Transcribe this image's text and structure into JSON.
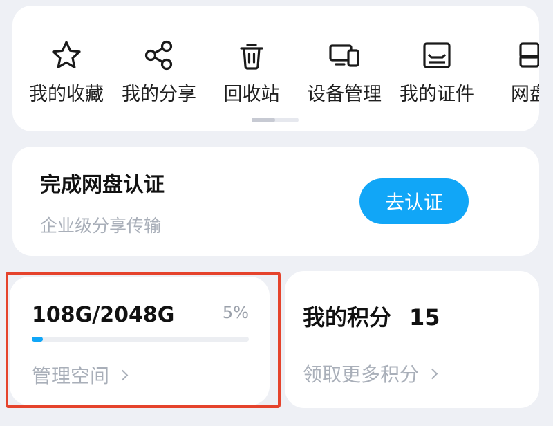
{
  "shortcuts": [
    {
      "label": "我的收藏",
      "icon": "star-icon"
    },
    {
      "label": "我的分享",
      "icon": "share-icon"
    },
    {
      "label": "回收站",
      "icon": "trash-icon"
    },
    {
      "label": "设备管理",
      "icon": "devices-icon"
    },
    {
      "label": "我的证件",
      "icon": "id-card-icon"
    },
    {
      "label": "网盘",
      "icon": "cloud-drive-icon"
    }
  ],
  "cert": {
    "title": "完成网盘认证",
    "subtitle": "企业级分享传输",
    "button_label": "去认证"
  },
  "storage": {
    "used_label": "108G/2048G",
    "percent_label": "5%",
    "usage_fraction": 0.05,
    "link_label": "管理空间"
  },
  "points": {
    "title": "我的积分",
    "value": "15",
    "link_label": "领取更多积分"
  },
  "colors": {
    "accent": "#11a6f7",
    "background": "#eef0f5",
    "selection": "#e5432c"
  }
}
